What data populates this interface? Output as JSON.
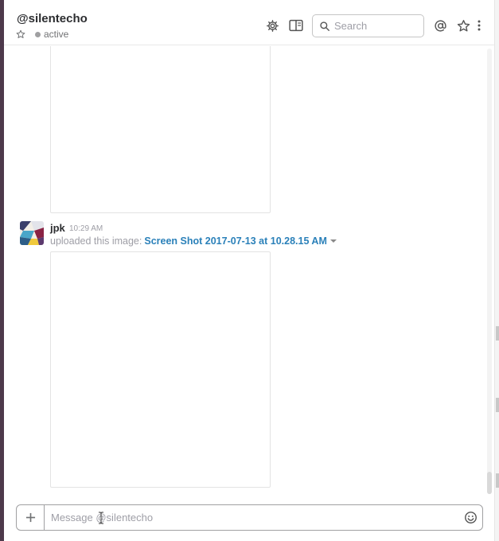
{
  "header": {
    "channel_name": "@silentecho",
    "status": "active",
    "search_placeholder": "Search"
  },
  "icons": {
    "star": "star-icon",
    "presence": "presence-dot",
    "settings": "gear-icon",
    "details": "sidebar-toggle-icon",
    "search": "search-icon",
    "mentions": "at-sign-icon",
    "starred": "star-icon",
    "more": "more-vertical-icon",
    "attach": "plus-icon",
    "emoji": "smiley-icon"
  },
  "message": {
    "sender": "jpk",
    "time": "10:29 AM",
    "prefix": "uploaded this image:",
    "file_name": "Screen Shot 2017-07-13 at 10.28.15 AM"
  },
  "composer": {
    "placeholder": "Message @silentecho"
  },
  "colors": {
    "sidebar": "#4d394b",
    "link": "#2a80b9",
    "muted": "#9e9ea6",
    "text": "#2c2d30"
  }
}
